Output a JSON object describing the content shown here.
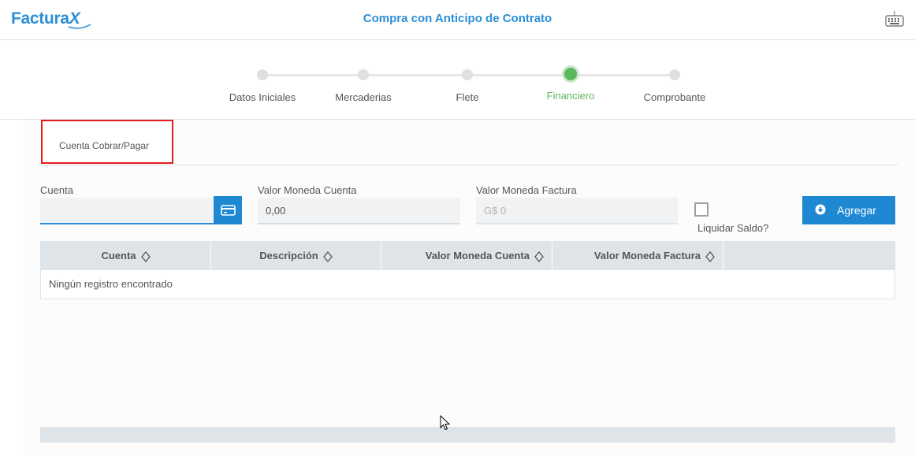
{
  "header": {
    "logo_text": "Factura",
    "logo_x": "X",
    "page_title": "Compra con Anticipo de Contrato"
  },
  "stepper": {
    "steps": [
      {
        "label": "Datos Iniciales",
        "active": false
      },
      {
        "label": "Mercaderias",
        "active": false
      },
      {
        "label": "Flete",
        "active": false
      },
      {
        "label": "Financiero",
        "active": true
      },
      {
        "label": "Comprobante",
        "active": false
      }
    ],
    "active_color": "#5cb85c"
  },
  "tabs": {
    "active_label": "Cuenta Cobrar/Pagar"
  },
  "form": {
    "cuenta_label": "Cuenta",
    "cuenta_value": "",
    "valor_moneda_cuenta_label": "Valor Moneda Cuenta",
    "valor_moneda_cuenta_value": "0,00",
    "valor_moneda_factura_label": "Valor Moneda Factura",
    "valor_moneda_factura_placeholder": "G$ 0",
    "liquidar_saldo_label": "Liquidar Saldo?",
    "liquidar_saldo_checked": false,
    "agregar_label": "Agregar"
  },
  "table": {
    "columns": [
      "Cuenta",
      "Descripción",
      "Valor Moneda Cuenta",
      "Valor Moneda Factura"
    ],
    "empty_message": "Ningún registro encontrado",
    "rows": []
  },
  "colors": {
    "brand": "#2b8fd6",
    "primary_button": "#1f88d2",
    "highlight_border": "#e11d1d"
  }
}
